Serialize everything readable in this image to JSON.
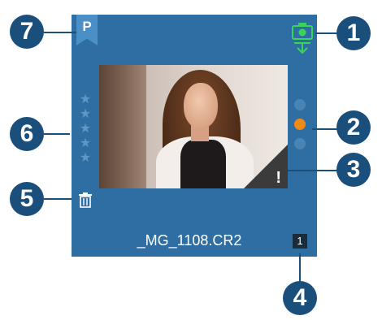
{
  "tile": {
    "bookmark_letter": "P",
    "filename": "_MG_1108.CR2",
    "index": "1",
    "warning_mark": "!",
    "rating_stars": 5,
    "color_labels": [
      "inactive",
      "active",
      "inactive"
    ],
    "colors": {
      "tile": "#2f6ea3",
      "active_label": "#ef8a12",
      "camera": "#3bd45a",
      "callout": "#1a4f7c"
    }
  },
  "callouts": [
    "1",
    "2",
    "3",
    "4",
    "5",
    "6",
    "7"
  ],
  "icons": [
    "bookmark-icon",
    "camera-import-icon",
    "star-icon",
    "color-label-dot",
    "warning-icon",
    "trash-icon"
  ]
}
